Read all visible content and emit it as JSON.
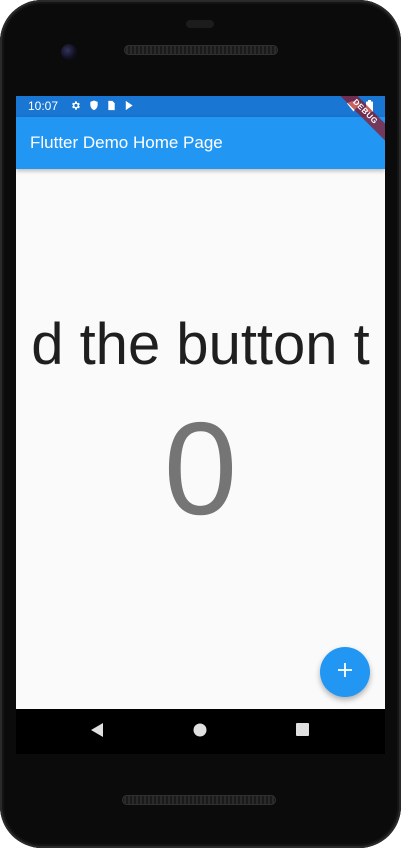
{
  "status_bar": {
    "time": "10:07",
    "left_icons": [
      "gear-icon",
      "shield-icon",
      "sim-card-icon",
      "play-store-icon"
    ],
    "right_icons": [
      "wifi-icon",
      "battery-icon"
    ],
    "color": "#1976d2"
  },
  "debug_banner": {
    "label": "DEBUG"
  },
  "app_bar": {
    "title": "Flutter Demo Home Page",
    "color": "#2196f3"
  },
  "main": {
    "message": "d the button t",
    "counter": "0"
  },
  "fab": {
    "icon": "add-icon",
    "color": "#2196f3"
  },
  "nav_bar": {
    "buttons": [
      "back-icon",
      "home-icon",
      "recent-apps-icon"
    ]
  }
}
